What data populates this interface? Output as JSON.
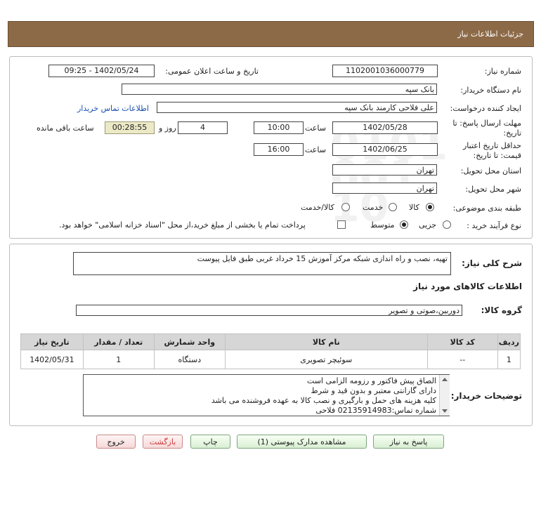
{
  "header": {
    "title": "جزئیات اطلاعات نیاز"
  },
  "fields": {
    "need_number_label": "شماره نیاز:",
    "need_number": "1102001036000779",
    "announce_label": "تاریخ و ساعت اعلان عمومی:",
    "announce_value": "1402/05/24 - 09:25",
    "buyer_org_label": "نام دستگاه خریدار:",
    "buyer_org": "بانک سپه",
    "requester_label": "ایجاد کننده درخواست:",
    "requester": "علی فلاحی کارمند بانک سپه",
    "contact_link": "اطلاعات تماس خریدار",
    "deadline_label_1": "مهلت ارسال پاسخ: تا",
    "deadline_label_2": "تاریخ:",
    "deadline_date": "1402/05/28",
    "time_label": "ساعت",
    "deadline_time": "10:00",
    "days_label": "روز و",
    "days": "4",
    "remaining_time": "00:28:55",
    "remaining_label": "ساعت باقی مانده",
    "validity_label_1": "حداقل تاریخ اعتبار",
    "validity_label_2": "قیمت: تا تاریخ:",
    "validity_date": "1402/06/25",
    "validity_time": "16:00",
    "province_label": "استان محل تحویل:",
    "province": "تهران",
    "city_label": "شهر محل تحویل:",
    "city": "تهران",
    "category_label": "طبقه بندی موضوعی:",
    "category_options": [
      "کالا",
      "خدمت",
      "کالا/خدمت"
    ],
    "process_label": "نوع فرآیند خرید :",
    "process_options": [
      "جزیی",
      "متوسط"
    ],
    "payment_note": "پرداخت تمام یا بخشی از مبلغ خرید،از محل \"اسناد خزانه اسلامی\" خواهد بود."
  },
  "description": {
    "label": "شرح کلی نیاز:",
    "value": "تهیه، نصب و راه اندازی شبکه مرکز آموزش 15 خرداد غربی طبق فایل پیوست"
  },
  "goods_section_title": "اطلاعات کالاهای مورد نیاز",
  "goods_group": {
    "label": "گروه کالا:",
    "value": "دوربین،صوتی و تصویر"
  },
  "table": {
    "headers": [
      "ردیف",
      "کد کالا",
      "نام کالا",
      "واحد شمارش",
      "تعداد / مقدار",
      "تاریخ نیاز"
    ],
    "rows": [
      [
        "1",
        "--",
        "سوئیچر تصویری",
        "دستگاه",
        "1",
        "1402/05/31"
      ]
    ]
  },
  "buyer_notes": {
    "label": "توضیحات خریدار:",
    "lines": [
      "الصاق پیش فاکتور و رزومه الزامی است",
      "دارای گارانتی معتبر و بدون قید و شرط",
      "کلیه هزینه های حمل و بارگیری و نصب کالا به عهده فروشنده می باشد",
      "شماره تماس:02135914983 فلاحی"
    ]
  },
  "buttons": {
    "reply": "پاسخ به نیاز",
    "attachments": "مشاهده مدارک پیوستی (1)",
    "print": "چاپ",
    "back": "بازگشت",
    "exit": "خروج"
  },
  "watermark": {
    "brand": "ParsNamadData"
  },
  "colors": {
    "header_bg": "#8d6a47",
    "remaining_bg": "#ece9c7",
    "link": "#1a4fb0"
  }
}
